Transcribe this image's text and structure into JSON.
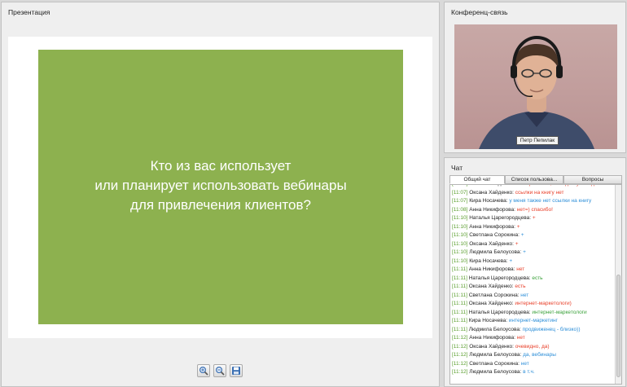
{
  "presentation": {
    "title": "Презентация",
    "slide_lines": [
      "Кто из вас использует",
      "или планирует использовать вебинары",
      "для привлечения клиентов?"
    ],
    "slide_color": "#8db14f",
    "toolbar": [
      "zoom-in-icon",
      "zoom-out-icon",
      "save-icon"
    ]
  },
  "conference": {
    "title": "Конференц-связь",
    "presenter_name": "Петр Пепилак"
  },
  "chat": {
    "title": "Чат",
    "tabs": [
      "Общий чат",
      "Список пользова...",
      "Вопросы"
    ],
    "messages": [
      {
        "time": "[11:07]",
        "author": "Оксана Хайденко:",
        "text": "есть фотошоп, есть доступ и т.д.",
        "color": "#e8402a"
      },
      {
        "time": "[11:07]",
        "author": "Оксана Хайденко:",
        "text": "ссылки на книгу нет",
        "color": "#e8402a"
      },
      {
        "time": "[11:07]",
        "author": "Кира Носачева:",
        "text": "у меня также нет ссылки на книгу",
        "color": "#2e8fd8"
      },
      {
        "time": "[11:08]",
        "author": "Анна Никифорова:",
        "text": "нет=) спасибо!",
        "color": "#e8402a"
      },
      {
        "time": "[11:10]",
        "author": "Наталья Царегородцева:",
        "text": "+",
        "color": "#e8402a"
      },
      {
        "time": "[11:10]",
        "author": "Анна Никифорова:",
        "text": "+",
        "color": "#e8402a"
      },
      {
        "time": "[11:10]",
        "author": "Светлана Сорокина:",
        "text": "+",
        "color": "#2e8fd8"
      },
      {
        "time": "[11:10]",
        "author": "Оксана Хайденко:",
        "text": "+",
        "color": "#e8402a"
      },
      {
        "time": "[11:10]",
        "author": "Людмила Белоусова:",
        "text": "+",
        "color": "#2e8fd8"
      },
      {
        "time": "[11:10]",
        "author": "Кира Носачева:",
        "text": "+",
        "color": "#2e8fd8"
      },
      {
        "time": "[11:11]",
        "author": "Анна Никифорова:",
        "text": "нет",
        "color": "#e8402a"
      },
      {
        "time": "[11:11]",
        "author": "Наталья Царегородцева:",
        "text": "есть",
        "color": "#3aa13a"
      },
      {
        "time": "[11:11]",
        "author": "Оксана Хайденко:",
        "text": "есть",
        "color": "#e8402a"
      },
      {
        "time": "[11:11]",
        "author": "Светлана Сорокина:",
        "text": "нет",
        "color": "#2e8fd8"
      },
      {
        "time": "[11:11]",
        "author": "Оксана Хайденко:",
        "text": "интернет-маркетологи)",
        "color": "#e8402a"
      },
      {
        "time": "[11:11]",
        "author": "Наталья Царегородцева:",
        "text": "интернет-маркетологи",
        "color": "#3aa13a"
      },
      {
        "time": "[11:11]",
        "author": "Кира Носачева:",
        "text": "интернет-маркетинг",
        "color": "#2e8fd8"
      },
      {
        "time": "[11:11]",
        "author": "Людмила Белоусова:",
        "text": "продвиженец - близко))",
        "color": "#2e8fd8"
      },
      {
        "time": "[11:12]",
        "author": "Анна Никифорова:",
        "text": "нет",
        "color": "#e8402a"
      },
      {
        "time": "[11:12]",
        "author": "Оксана Хайденко:",
        "text": "очевидно, да)",
        "color": "#e8402a"
      },
      {
        "time": "[11:12]",
        "author": "Людмила Белоусова:",
        "text": "да, вебинары",
        "color": "#2e8fd8"
      },
      {
        "time": "[11:12]",
        "author": "Светлана Сорокина:",
        "text": "нет",
        "color": "#2e8fd8"
      },
      {
        "time": "[11:12]",
        "author": "Людмила Белоусова:",
        "text": "в т.ч.",
        "color": "#2e8fd8"
      }
    ]
  }
}
